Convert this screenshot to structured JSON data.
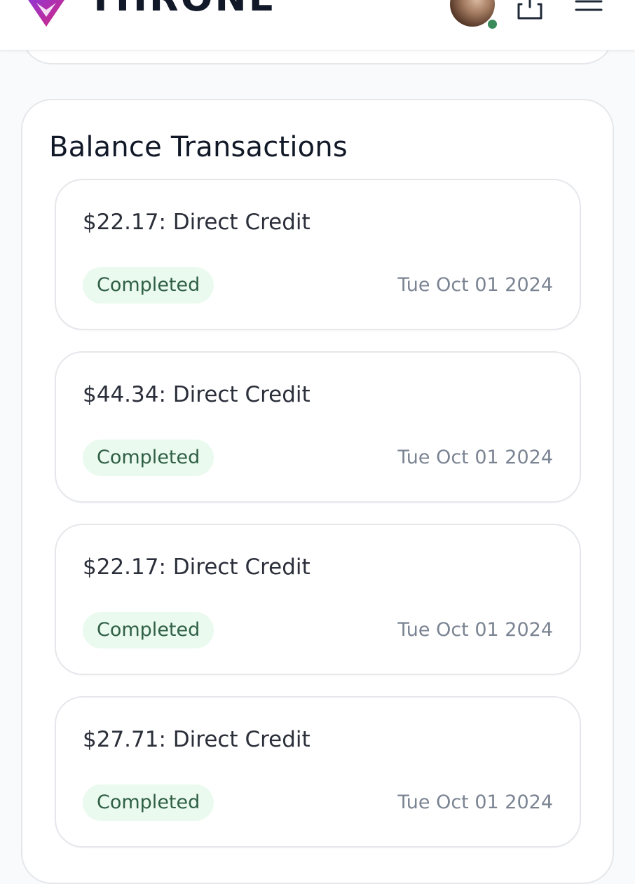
{
  "header": {
    "brand": "THRONE",
    "icons": [
      "logo-icon",
      "avatar",
      "share-icon",
      "menu-icon"
    ]
  },
  "section": {
    "title": "Balance Transactions",
    "transactions": [
      {
        "amount": "$22.17: Direct Credit",
        "status": "Completed",
        "date": "Tue Oct 01 2024"
      },
      {
        "amount": "$44.34: Direct Credit",
        "status": "Completed",
        "date": "Tue Oct 01 2024"
      },
      {
        "amount": "$22.17: Direct Credit",
        "status": "Completed",
        "date": "Tue Oct 01 2024"
      },
      {
        "amount": "$27.71: Direct Credit",
        "status": "Completed",
        "date": "Tue Oct 01 2024"
      }
    ]
  },
  "colors": {
    "badge_bg": "#eafaee",
    "badge_text": "#2f5f45",
    "online": "#3b8a5a",
    "brand_gradient": [
      "#7c3aed",
      "#db2777"
    ]
  }
}
